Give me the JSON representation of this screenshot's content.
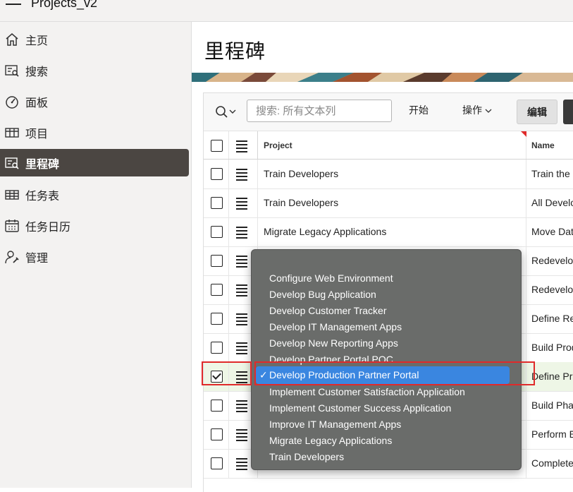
{
  "app": {
    "title": "Projects_v2"
  },
  "nav": {
    "items": [
      {
        "label": "主页",
        "icon": "home-icon"
      },
      {
        "label": "搜索",
        "icon": "search-form-icon"
      },
      {
        "label": "面板",
        "icon": "dashboard-icon"
      },
      {
        "label": "项目",
        "icon": "table-icon"
      },
      {
        "label": "里程碑",
        "icon": "milestone-icon",
        "active": true
      },
      {
        "label": "任务表",
        "icon": "grid-icon"
      },
      {
        "label": "任务日历",
        "icon": "calendar-icon"
      },
      {
        "label": "管理",
        "icon": "admin-icon"
      }
    ]
  },
  "page": {
    "title": "里程碑"
  },
  "toolbar": {
    "search_placeholder": "搜索: 所有文本列",
    "go_label": "开始",
    "actions_label": "操作",
    "edit_label": "编辑"
  },
  "grid": {
    "columns": [
      "Project",
      "Name"
    ],
    "rows": [
      {
        "project": "Train Developers",
        "name": "Train the"
      },
      {
        "project": "Train Developers",
        "name": "All Develo"
      },
      {
        "project": "Migrate Legacy Applications",
        "name": "Move Dat"
      },
      {
        "project": "",
        "name": "Redevelop"
      },
      {
        "project": "",
        "name": "Redevelop"
      },
      {
        "project": "",
        "name": "Define Re"
      },
      {
        "project": "",
        "name": "Build Prod"
      },
      {
        "project": "",
        "name": "Define Pro",
        "selected": true
      },
      {
        "project": "",
        "name": "Build Pha"
      },
      {
        "project": "",
        "name": "Perform E"
      },
      {
        "project": "",
        "name": "Complete"
      }
    ]
  },
  "dropdown": {
    "options": [
      "Configure Web Environment",
      "Develop Bug Application",
      "Develop Customer Tracker",
      "Develop IT Management Apps",
      "Develop New Reporting Apps",
      "Develop Partner Portal POC",
      "Develop Production Partner Portal",
      "Implement Customer Satisfaction Application",
      "Implement Customer Success Application",
      "Improve IT Management Apps",
      "Migrate Legacy Applications",
      "Train Developers"
    ],
    "selected_index": 6,
    "check_glyph": "✓"
  },
  "colors": {
    "nav_active_bg": "#4b4642",
    "selection_blue": "#3a86e0",
    "highlight_red": "#e02a2a",
    "selected_row_bg": "#eef6e6"
  }
}
